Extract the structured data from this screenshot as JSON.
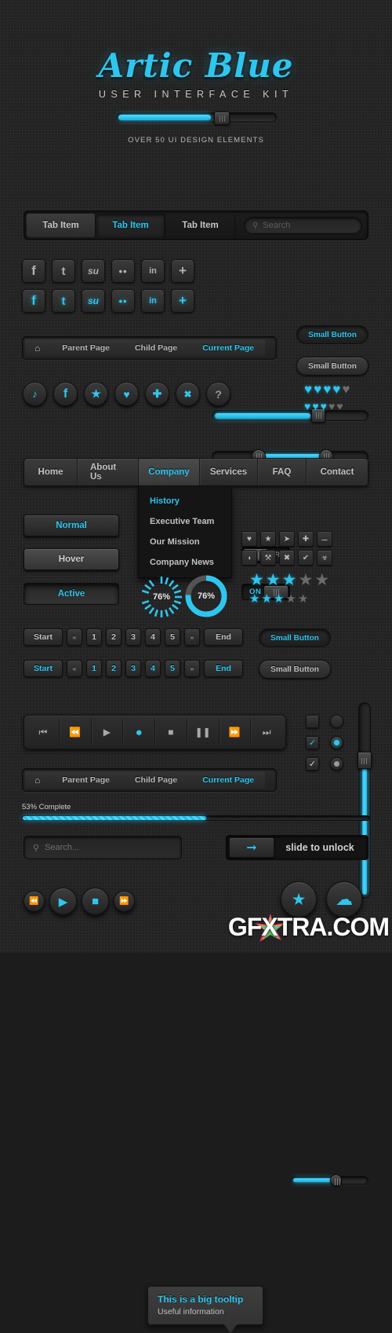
{
  "accent": "#2ec6ee",
  "background": "#252525",
  "header": {
    "title": "Artic Blue",
    "subtitle": "USER INTERFACE KIT",
    "tagline": "OVER 50 UI DESIGN ELEMENTS",
    "slider_value": 58
  },
  "tabs": {
    "items": [
      {
        "label": "Tab Item",
        "active": false
      },
      {
        "label": "Tab Item",
        "active": true
      },
      {
        "label": "Tab Item",
        "active": false
      }
    ],
    "search_placeholder": "Search",
    "search_icon": "search-icon"
  },
  "social_squares": {
    "row_gray": [
      "f",
      "t",
      "su",
      "••",
      "in",
      "+"
    ],
    "row_blue": [
      "f",
      "t",
      "su",
      "••",
      "in",
      "+"
    ],
    "names": [
      "facebook",
      "twitter",
      "stumbleupon",
      "flickr",
      "linkedin",
      "plus"
    ]
  },
  "sliders": {
    "top_single": {
      "value": 62,
      "knob": "square"
    },
    "range": {
      "start": 28,
      "end": 72,
      "knob": "round"
    },
    "vertical": {
      "value": 72
    },
    "small_bottom": {
      "value": 55
    }
  },
  "small_buttons": [
    {
      "label": "Small Button",
      "state": "active"
    },
    {
      "label": "Small Button",
      "state": "normal"
    },
    {
      "label": "Small Button",
      "state": "active"
    },
    {
      "label": "Small Button",
      "state": "normal"
    }
  ],
  "breadcrumb": {
    "home_icon": "home-icon",
    "items": [
      {
        "label": "Parent Page",
        "current": false
      },
      {
        "label": "Child Page",
        "current": false
      },
      {
        "label": "Current Page",
        "current": true
      }
    ]
  },
  "circle_icons": [
    {
      "icon": "twitter-bird-icon",
      "glyph": "ᴠ",
      "blue": true
    },
    {
      "icon": "facebook-icon",
      "glyph": "f",
      "blue": true
    },
    {
      "icon": "star-icon",
      "glyph": "★",
      "blue": true
    },
    {
      "icon": "heart-icon",
      "glyph": "♥",
      "blue": true
    },
    {
      "icon": "plus-icon",
      "glyph": "✚",
      "blue": true
    },
    {
      "icon": "close-x-icon",
      "glyph": "✖",
      "blue": true
    },
    {
      "icon": "help-question-icon",
      "glyph": "?",
      "blue": false
    }
  ],
  "toggles": [
    {
      "label": "OFF",
      "state": "off"
    },
    {
      "label": "ON",
      "state": "on"
    }
  ],
  "hearts": [
    {
      "filled": 4,
      "total": 5
    },
    {
      "filled": 3,
      "total": 5
    }
  ],
  "stars": [
    {
      "filled": 3,
      "total": 5,
      "size": "large"
    },
    {
      "filled": 3,
      "total": 5,
      "size": "small"
    }
  ],
  "main_nav": {
    "items": [
      {
        "label": "Home",
        "active": false
      },
      {
        "label": "About Us",
        "active": false
      },
      {
        "label": "Company",
        "active": true
      },
      {
        "label": "Services",
        "active": false
      },
      {
        "label": "FAQ",
        "active": false
      },
      {
        "label": "Contact",
        "active": false
      }
    ],
    "dropdown": [
      {
        "label": "History",
        "active": true
      },
      {
        "label": "Executive Team",
        "active": false
      },
      {
        "label": "Our Mission",
        "active": false
      },
      {
        "label": "Company News",
        "active": false
      }
    ]
  },
  "state_buttons": [
    {
      "label": "Normal",
      "state": "normal"
    },
    {
      "label": "Hover",
      "state": "hover"
    },
    {
      "label": "Active",
      "state": "active"
    }
  ],
  "icon_grid": [
    {
      "name": "heart-icon",
      "glyph": "♥"
    },
    {
      "name": "star-icon",
      "glyph": "★"
    },
    {
      "name": "tag-icon",
      "glyph": "➤"
    },
    {
      "name": "plus-icon",
      "glyph": "✚"
    },
    {
      "name": "minus-icon",
      "glyph": "➖"
    },
    {
      "name": "rss-icon",
      "glyph": "◠"
    },
    {
      "name": "wrench-icon",
      "glyph": "⚒"
    },
    {
      "name": "close-x-icon",
      "glyph": "✖"
    },
    {
      "name": "check-icon",
      "glyph": "✔"
    },
    {
      "name": "trash-icon",
      "glyph": "Ὕ1"
    }
  ],
  "progress_circles": [
    {
      "label": "76%",
      "value": 76,
      "style": "ticks"
    },
    {
      "label": "76%",
      "value": 76,
      "style": "ring"
    }
  ],
  "pagination": {
    "rows": [
      {
        "style": "gray",
        "items": [
          {
            "label": "Start",
            "type": "wide"
          },
          {
            "label": "«",
            "type": "arrow"
          },
          {
            "label": "1",
            "type": "num"
          },
          {
            "label": "2",
            "type": "num"
          },
          {
            "label": "3",
            "type": "num"
          },
          {
            "label": "4",
            "type": "num"
          },
          {
            "label": "5",
            "type": "num"
          },
          {
            "label": "»",
            "type": "arrow"
          },
          {
            "label": "End",
            "type": "wide"
          }
        ]
      },
      {
        "style": "blue",
        "items": [
          {
            "label": "Start",
            "type": "wide"
          },
          {
            "label": "«",
            "type": "arrow"
          },
          {
            "label": "1",
            "type": "num"
          },
          {
            "label": "2",
            "type": "num"
          },
          {
            "label": "3",
            "type": "num"
          },
          {
            "label": "4",
            "type": "num"
          },
          {
            "label": "5",
            "type": "num"
          },
          {
            "label": "»",
            "type": "arrow"
          },
          {
            "label": "End",
            "type": "wide"
          }
        ]
      }
    ]
  },
  "player": {
    "buttons": [
      {
        "name": "skip-back-icon",
        "glyph": "⧏|",
        "blue": false
      },
      {
        "name": "rewind-icon",
        "glyph": "◀◀",
        "blue": false
      },
      {
        "name": "play-icon",
        "glyph": "▶",
        "blue": false
      },
      {
        "name": "record-icon",
        "glyph": "●",
        "blue": true
      },
      {
        "name": "stop-icon",
        "glyph": "■",
        "blue": false
      },
      {
        "name": "pause-icon",
        "glyph": "Ⅱ",
        "blue": false
      },
      {
        "name": "fast-forward-icon",
        "glyph": "▶▶",
        "blue": false
      },
      {
        "name": "skip-forward-icon",
        "glyph": "|⧐",
        "blue": false
      }
    ]
  },
  "checkboxes": [
    {
      "checked": false,
      "accent": false
    },
    {
      "checked": true,
      "accent": true
    },
    {
      "checked": true,
      "accent": false
    }
  ],
  "radios": [
    {
      "selected": false,
      "accent": false
    },
    {
      "selected": true,
      "accent": true
    },
    {
      "selected": true,
      "accent": false
    }
  ],
  "progress_bar": {
    "label": "53% Complete",
    "value": 53
  },
  "search_field": {
    "placeholder": "Search...",
    "icon": "search-icon"
  },
  "unlock": {
    "arrow_icon": "arrow-right-icon",
    "label": "slide to unlock"
  },
  "media_circles": [
    {
      "name": "rewind-icon",
      "glyph": "◀◀",
      "size": "small"
    },
    {
      "name": "play-icon",
      "glyph": "▶",
      "size": "large"
    },
    {
      "name": "stop-icon",
      "glyph": "■",
      "size": "large"
    },
    {
      "name": "fast-forward-icon",
      "glyph": "▶▶",
      "size": "small"
    }
  ],
  "tooltip": {
    "title": "This is a big tooltip",
    "subtitle": "Useful information"
  },
  "bottom_circles": [
    {
      "name": "star-icon",
      "glyph": "★"
    },
    {
      "name": "cloud-icon",
      "glyph": "☁"
    }
  ],
  "watermark": "GFXTRA.COM"
}
